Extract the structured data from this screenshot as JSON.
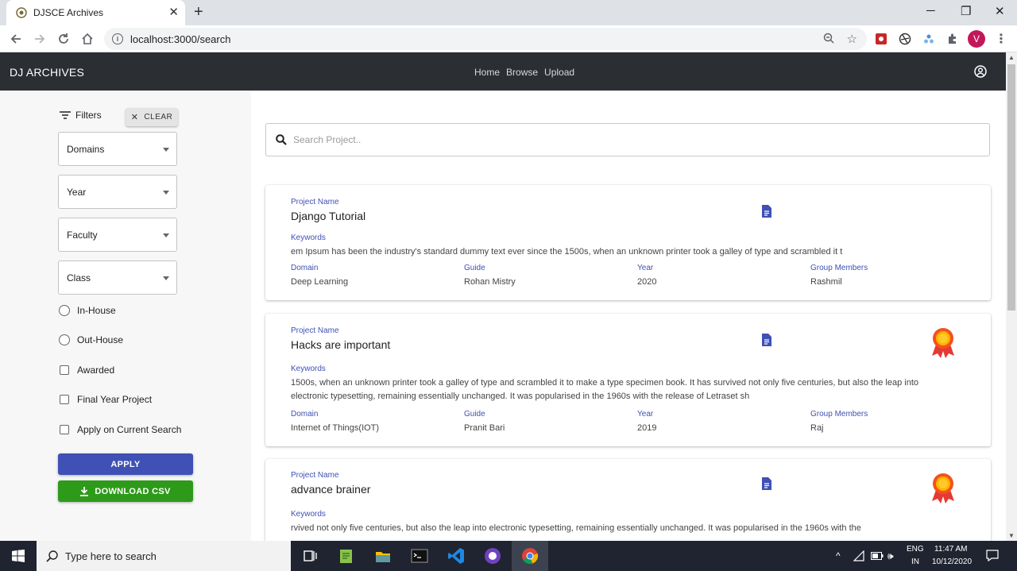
{
  "browser": {
    "tab_title": "DJSCE Archives",
    "url": "localhost:3000/search",
    "profile_initial": "V"
  },
  "app": {
    "brand": "DJ ARCHIVES",
    "nav": [
      "Home",
      "Browse",
      "Upload"
    ]
  },
  "sidebar": {
    "filters_label": "Filters",
    "clear_label": "CLEAR",
    "selects": [
      "Domains",
      "Year",
      "Faculty",
      "Class"
    ],
    "radios": [
      "In-House",
      "Out-House"
    ],
    "checkboxes": [
      "Awarded",
      "Final Year Project",
      "Apply on Current Search"
    ],
    "apply_label": "APPLY",
    "download_label": "DOWNLOAD CSV"
  },
  "search": {
    "placeholder": "Search Project.."
  },
  "labels": {
    "project_name": "Project Name",
    "keywords": "Keywords",
    "domain": "Domain",
    "guide": "Guide",
    "year": "Year",
    "group_members": "Group Members"
  },
  "projects": [
    {
      "name": "Django Tutorial",
      "keywords": "em Ipsum has been the industry's standard dummy text ever since the 1500s, when an unknown printer took a galley of type and scrambled it t",
      "domain": "Deep Learning",
      "guide": "Rohan Mistry",
      "year": "2020",
      "members": "Rashmil",
      "awarded": false
    },
    {
      "name": "Hacks are important",
      "keywords": "1500s, when an unknown printer took a galley of type and scrambled it to make a type specimen book. It has survived not only five centuries, but also the leap into electronic typesetting, remaining essentially unchanged. It was popularised in the 1960s with the release of Letraset sh",
      "domain": "Internet of Things(IOT)",
      "guide": "Pranit Bari",
      "year": "2019",
      "members": "Raj",
      "awarded": true
    },
    {
      "name": "advance brainer",
      "keywords": "rvived not only five centuries, but also the leap into electronic typesetting, remaining essentially unchanged. It was popularised in the 1960s with the",
      "awarded": true
    }
  ],
  "taskbar": {
    "search_placeholder": "Type here to search",
    "lang_top": "ENG",
    "lang_bottom": "IN",
    "time": "11:47 AM",
    "date": "10/12/2020"
  },
  "colors": {
    "appbar": "#2b2e33",
    "accent": "#3f51b5",
    "apply": "#3f51b5",
    "download": "#2e9a1a"
  }
}
